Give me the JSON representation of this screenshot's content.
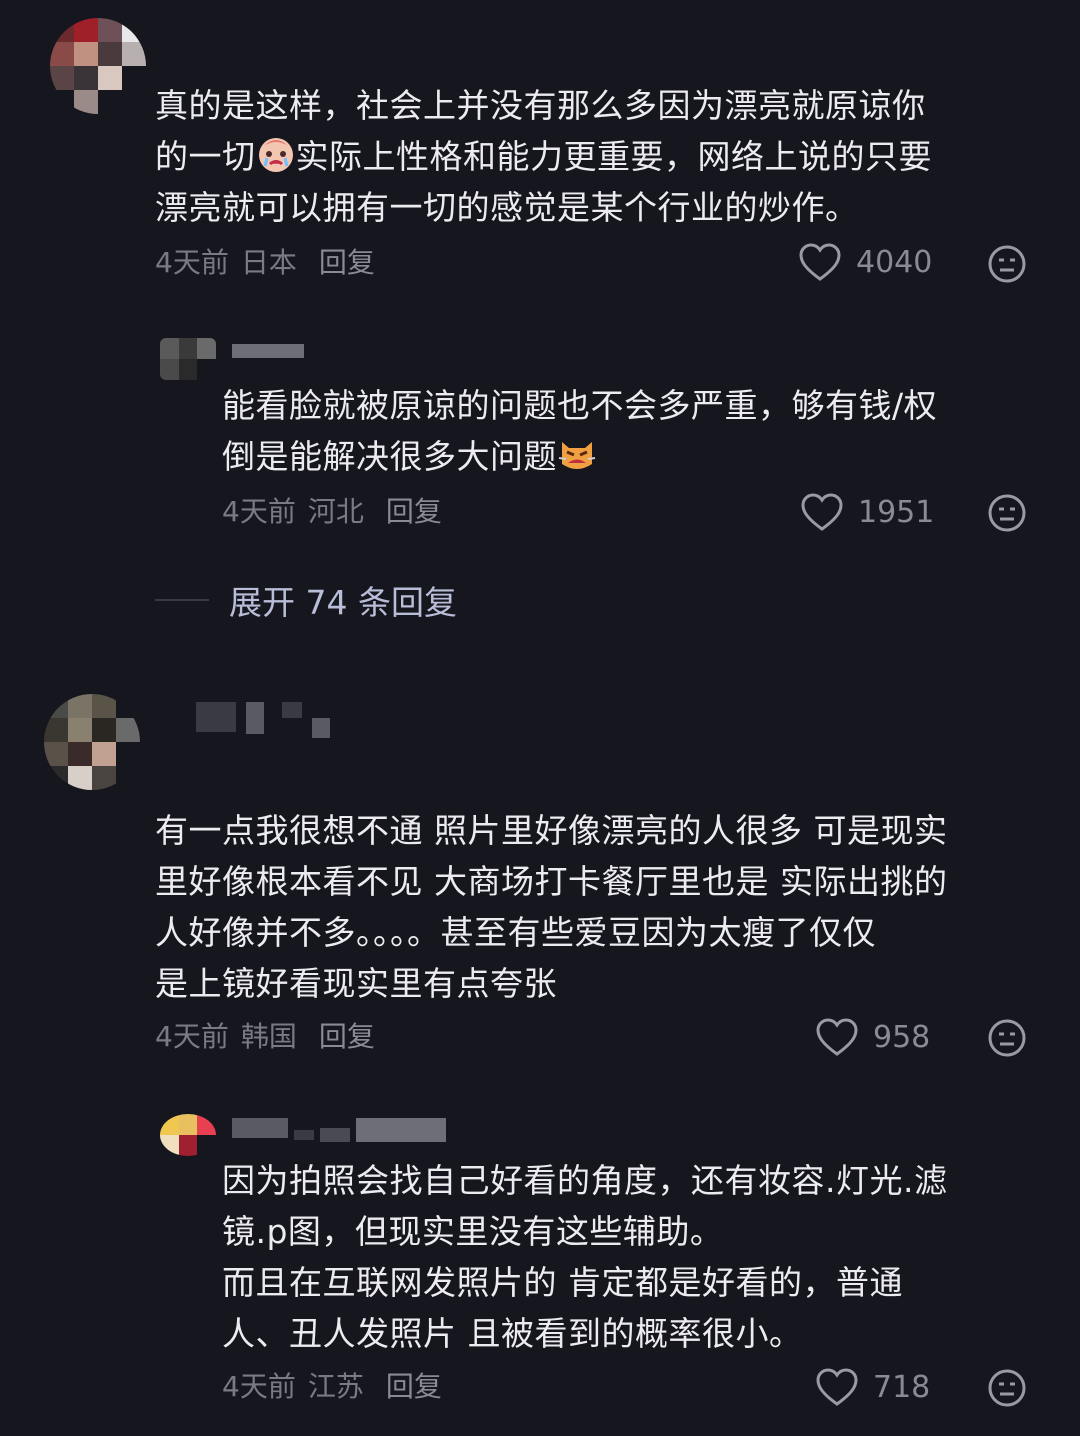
{
  "comments": [
    {
      "text_lines": [
        "真的是这样，社会上并没有那么多因为漂亮就原谅你",
        "的一切",
        "实际上性格和能力更重要，网络上说的只要",
        "漂亮就可以拥有一切的感觉是某个行业的炒作。"
      ],
      "time": "4天前",
      "location": "日本",
      "reply_label": "回复",
      "likes": "4040",
      "reply": {
        "text_lines": [
          "能看脸就被原谅的问题也不会多严重，够有钱/权",
          "倒是能解决很多大问题"
        ],
        "time": "4天前",
        "location": "河北",
        "reply_label": "回复",
        "likes": "1951"
      },
      "expand_label": "展开 74 条回复"
    },
    {
      "text_lines": [
        "有一点我很想不通 照片里好像漂亮的人很多 可是现实",
        "里好像根本看不见 大商场打卡餐厅里也是 实际出挑的",
        "人好像并不多。。。。甚至有些爱豆因为太瘦了仅仅",
        "是上镜好看现实里有点夸张"
      ],
      "time": "4天前",
      "location": "韩国",
      "reply_label": "回复",
      "likes": "958",
      "reply": {
        "text_lines": [
          "因为拍照会找自己好看的角度，还有妆容.灯光.滤",
          "镜.p图，但现实里没有这些辅助。",
          "而且在互联网发照片的 肯定都是好看的，普通",
          "人、丑人发照片 且被看到的概率很小。"
        ],
        "time": "4天前",
        "location": "江苏",
        "reply_label": "回复",
        "likes": "718"
      }
    }
  ],
  "icons": {
    "like": "heart-outline-icon",
    "dislike": "meh-face-icon",
    "emoji1": "crying-face-emoji",
    "emoji2": "angry-cat-emoji"
  }
}
